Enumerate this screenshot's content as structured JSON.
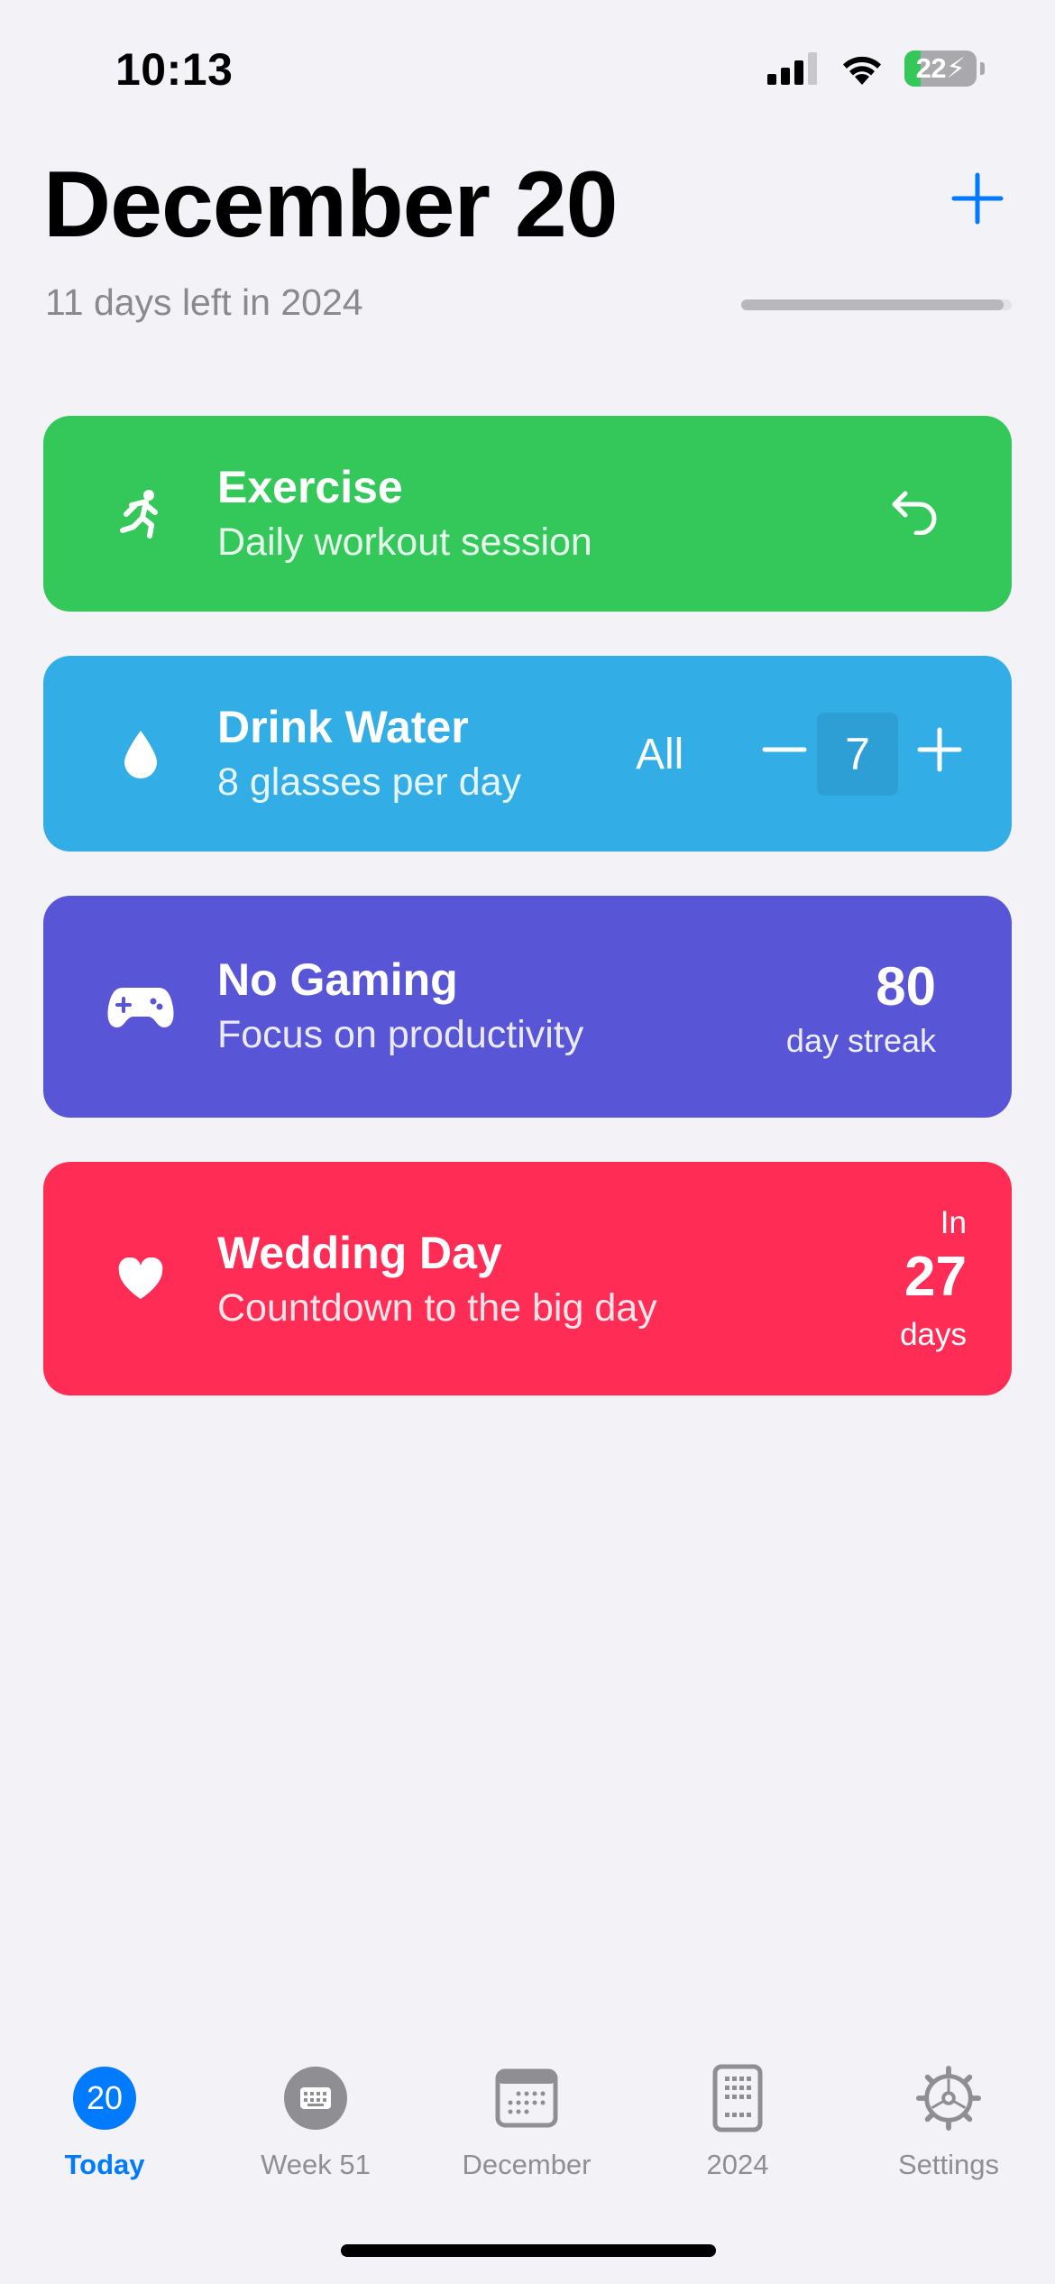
{
  "status_bar": {
    "time": "10:13",
    "battery_level": "22",
    "battery_fraction": 0.22,
    "icons": [
      "cellular-signal-icon",
      "wifi-icon",
      "battery-charging-icon"
    ]
  },
  "header": {
    "title": "December 20",
    "subtitle": "11 days left in 2024",
    "year_progress_fraction": 0.97,
    "accent_color": "#007aff"
  },
  "cards": {
    "exercise": {
      "title": "Exercise",
      "subtitle": "Daily workout session",
      "color": "#34c759",
      "icon": "running-figure-icon",
      "action_icon": "undo-icon"
    },
    "water": {
      "title": "Drink Water",
      "subtitle": "8 glasses per day",
      "color": "#32ade6",
      "icon": "water-drop-icon",
      "all_label": "All",
      "count": "7"
    },
    "gaming": {
      "title": "No Gaming",
      "subtitle": "Focus on productivity",
      "color": "#5856d6",
      "icon": "gamecontroller-icon",
      "streak_value": "80",
      "streak_label": "day streak"
    },
    "wedding": {
      "title": "Wedding Day",
      "subtitle": "Countdown to the big day",
      "color": "#ff2d55",
      "icon": "heart-icon",
      "prefix": "In",
      "value": "27",
      "suffix": "days"
    }
  },
  "tabbar": {
    "tabs": [
      {
        "label": "Today",
        "badge": "20",
        "active": true
      },
      {
        "label": "Week 51",
        "active": false
      },
      {
        "label": "December",
        "active": false
      },
      {
        "label": "2024",
        "active": false
      },
      {
        "label": "Settings",
        "active": false
      }
    ]
  }
}
